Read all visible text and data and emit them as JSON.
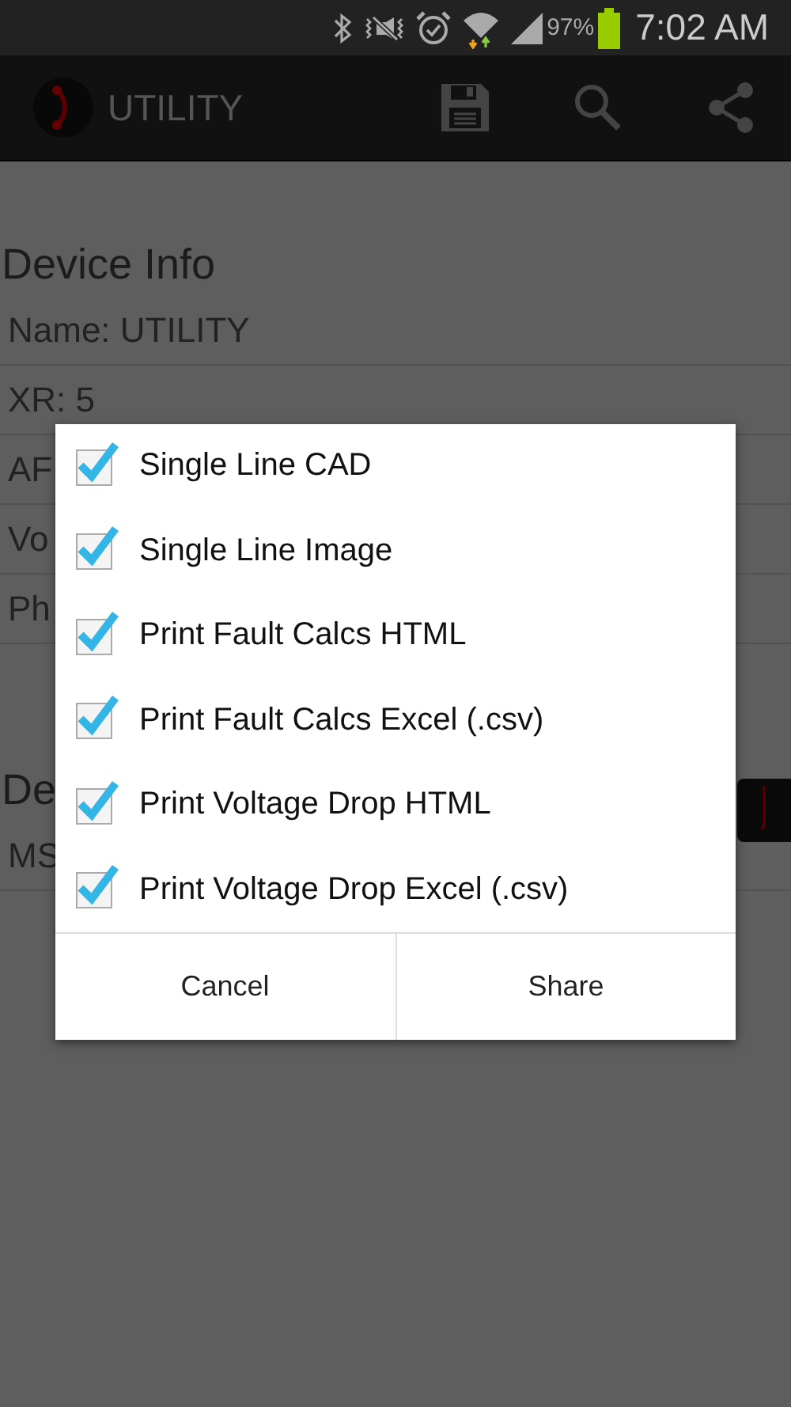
{
  "status_bar": {
    "battery_text": "97%",
    "time": "7:02 AM"
  },
  "app_bar": {
    "title": "UTILITY"
  },
  "sections": [
    {
      "title": "Device Info",
      "rows": [
        "Name: UTILITY",
        "XR: 5",
        "AF",
        "Vo",
        "Ph"
      ]
    },
    {
      "title": "De",
      "rows": [
        "MS"
      ]
    }
  ],
  "dialog": {
    "items": [
      {
        "label": "Single Line CAD",
        "checked": true
      },
      {
        "label": "Single Line Image",
        "checked": true
      },
      {
        "label": "Print Fault Calcs HTML",
        "checked": true
      },
      {
        "label": "Print Fault Calcs Excel (.csv)",
        "checked": true
      },
      {
        "label": "Print Voltage Drop HTML",
        "checked": true
      },
      {
        "label": "Print Voltage Drop Excel (.csv)",
        "checked": true
      }
    ],
    "buttons": [
      "Cancel",
      "Share"
    ]
  }
}
